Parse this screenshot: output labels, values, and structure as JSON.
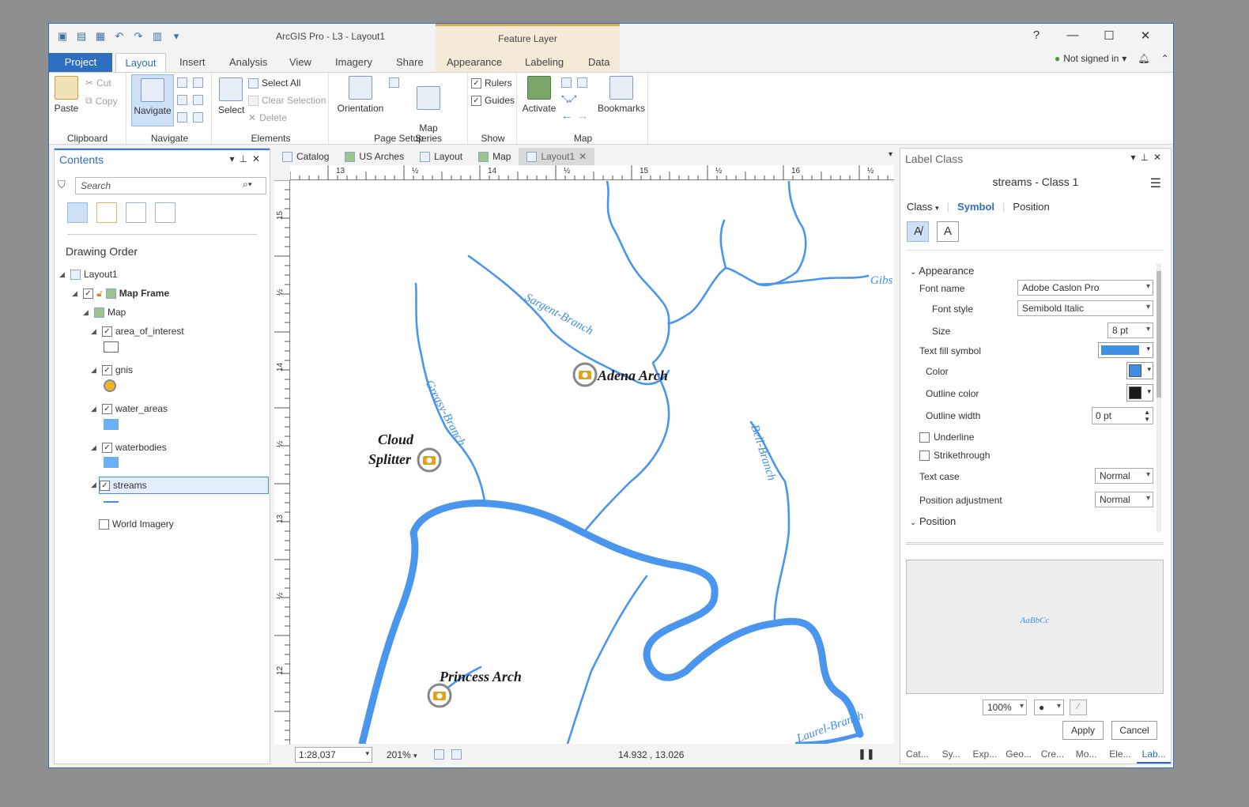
{
  "title": "ArcGIS Pro - L3 - Layout1",
  "context_tab": "Feature Layer",
  "ribbon_tabs": [
    "Project",
    "Layout",
    "Insert",
    "Analysis",
    "View",
    "Imagery",
    "Share",
    "Appearance",
    "Labeling",
    "Data"
  ],
  "signin": "Not signed in",
  "help": "?",
  "ribbon": {
    "paste": "Paste",
    "cut": "Cut",
    "copy": "Copy",
    "clipboard": "Clipboard",
    "navigate": "Navigate",
    "navigate_group": "Navigate",
    "select": "Select",
    "select_all": "Select All",
    "clear_selection": "Clear Selection",
    "delete": "Delete",
    "elements": "Elements",
    "orientation": "Orientation",
    "map_series": "Map\nSeries",
    "page_setup": "Page Setup",
    "rulers": "Rulers",
    "guides": "Guides",
    "show": "Show",
    "activate": "Activate",
    "bookmarks": "Bookmarks",
    "map": "Map"
  },
  "contents": {
    "title": "Contents",
    "search_placeholder": "Search",
    "drawing_order": "Drawing Order",
    "layers": {
      "layout1": "Layout1",
      "map_frame": "Map Frame",
      "map": "Map",
      "area": "area_of_interest",
      "gnis": "gnis",
      "water_areas": "water_areas",
      "waterbodies": "waterbodies",
      "streams": "streams",
      "world": "World Imagery"
    }
  },
  "doc_tabs": [
    "Catalog",
    "US Arches",
    "Layout",
    "Map",
    "Layout1"
  ],
  "ruler": {
    "h": [
      "13",
      "½",
      "14",
      "½",
      "15",
      "½",
      "16",
      "½"
    ],
    "v": [
      "15",
      "½",
      "14",
      "½",
      "13",
      "½",
      "12"
    ]
  },
  "map_labels": {
    "adena": "Adena Arch",
    "cloud1": "Cloud",
    "cloud2": "Splitter",
    "princess": "Princess Arch",
    "sargent": "Sargent-Branch",
    "greasy": "Greasy-Branch",
    "bell": "Bell-Branch",
    "laurel": "Laurel-Branch",
    "gibs": "Gibs"
  },
  "status": {
    "scale": "1:28,037",
    "zoom": "201%",
    "coords": "14.932 , 13.026"
  },
  "label_class": {
    "title": "Label Class",
    "subtitle": "streams - Class 1",
    "tab_class": "Class",
    "tab_symbol": "Symbol",
    "tab_position": "Position",
    "appearance": "Appearance",
    "font_name_label": "Font name",
    "font_name": "Adobe Caslon Pro",
    "font_style_label": "Font style",
    "font_style": "Semibold Italic",
    "size_label": "Size",
    "size": "8 pt",
    "text_fill_label": "Text fill symbol",
    "color_label": "Color",
    "outline_color_label": "Outline color",
    "outline_width_label": "Outline width",
    "outline_width": "0 pt",
    "underline": "Underline",
    "strikethrough": "Strikethrough",
    "text_case_label": "Text case",
    "text_case": "Normal",
    "pos_adj_label": "Position adjustment",
    "pos_adj": "Normal",
    "position": "Position",
    "preview": "AaBbCc",
    "preview_zoom": "100%",
    "apply": "Apply",
    "cancel": "Cancel",
    "bottom_tabs": [
      "Cat...",
      "Sy...",
      "Exp...",
      "Geo...",
      "Cre...",
      "Mo...",
      "Ele...",
      "Lab..."
    ]
  },
  "colors": {
    "accent": "#2d6ec0",
    "stream": "#3f8fe8",
    "gnis": "#e0a21a"
  }
}
